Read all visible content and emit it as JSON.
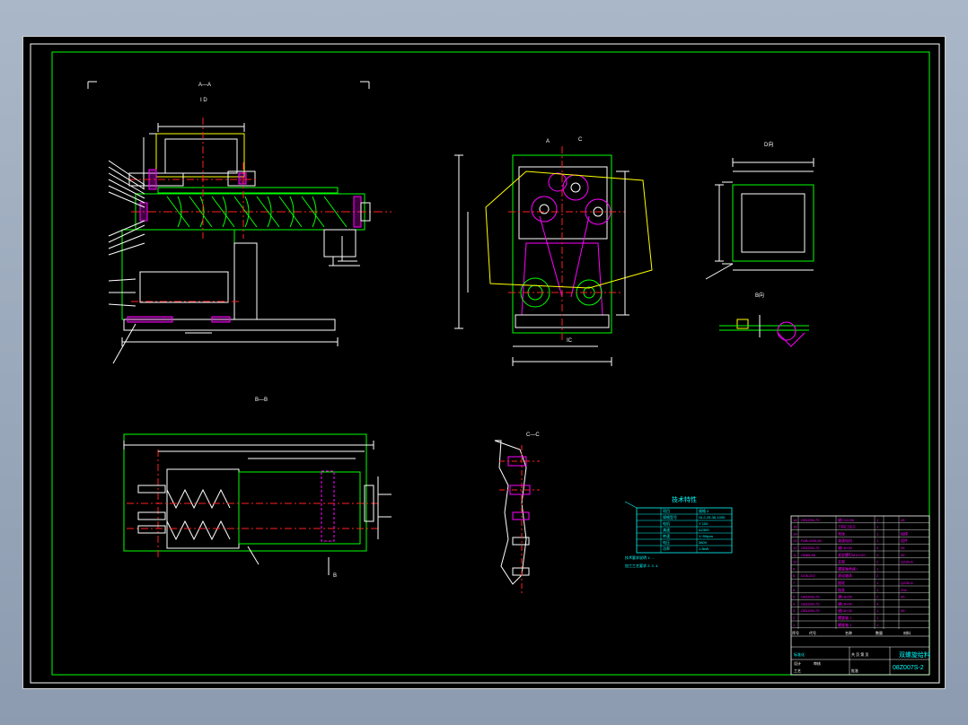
{
  "colors": {
    "background": "#000000",
    "frame": "#00ff00",
    "white_lines": "#ffffff",
    "yellow_lines": "#ffff00",
    "red_centerlines": "#ff2020",
    "magenta_parts": "#ff00ff",
    "cyan_text": "#00ffff"
  },
  "view_labels": {
    "section_aa": "A—A",
    "section_aa_sub": "I D",
    "section_bb": "B—B",
    "section_cc": "C—C",
    "view_d": "D向",
    "view_b": "B向",
    "mark_a": "A",
    "mark_c": "C",
    "mark_b": "B",
    "mark_ic": "IC"
  },
  "tech_table": {
    "title": "技术特性",
    "rows": [
      [
        "",
        "项目",
        "规格 2"
      ],
      [
        "",
        "规格型号",
        "GL2-25-36-1000"
      ],
      [
        "",
        "电机",
        "Y 100"
      ],
      [
        "",
        "减速",
        "A2300"
      ],
      [
        "",
        "转速",
        "1~90rpm"
      ],
      [
        "",
        "电压",
        "380V"
      ],
      [
        "",
        "功率",
        "1.5kW"
      ]
    ],
    "notes": [
      "技术要求说明 1:  ...",
      "加工工艺要求 2: 3. 4."
    ]
  },
  "title_block": {
    "title": "双螺旋给料",
    "drawing_no": "08Z007S-2",
    "parts": [
      [
        "16",
        "GB1096-79",
        "键C10×56",
        "1",
        "45"
      ],
      [
        "15",
        "",
        "下料口法兰",
        "1",
        ""
      ],
      [
        "14",
        "",
        "壳体",
        "1",
        "组焊"
      ],
      [
        "13",
        "FAB-10W-80",
        "减速电机",
        "1",
        "组件"
      ],
      [
        "12",
        "GB1096-79",
        "键C6×40",
        "4",
        "45"
      ],
      [
        "11",
        "GB85-86",
        "紧定螺钉M10×20",
        "4",
        "45"
      ],
      [
        "10",
        "",
        "支架",
        "2",
        "Q235-A"
      ],
      [
        "9",
        "",
        "螺旋轴承座 I",
        "1",
        ""
      ],
      [
        "8",
        "DOIL207",
        "滚动轴承",
        "2",
        ""
      ],
      [
        "7",
        "",
        "链轮",
        "1",
        "Q235-A"
      ],
      [
        "6",
        "",
        "链条",
        "1",
        "20#"
      ],
      [
        "5",
        "GB1096-79",
        "键C8×50",
        "2",
        "45"
      ],
      [
        "4",
        "GB1096-79",
        "键C8×40",
        "4",
        ""
      ],
      [
        "3",
        "GB1096-79",
        "键C6×30",
        "1",
        "45"
      ],
      [
        "2",
        "",
        "螺旋轴 1",
        "1",
        ""
      ],
      [
        "1",
        "",
        "螺旋轴 2",
        "1",
        ""
      ]
    ],
    "header": [
      "序号",
      "代号",
      "名称",
      "数量",
      "材料"
    ],
    "sign_rows": [
      "设计",
      "审核",
      "工艺",
      "批准"
    ],
    "scale_row": "共 页  第 页",
    "stamp": "标准化"
  }
}
